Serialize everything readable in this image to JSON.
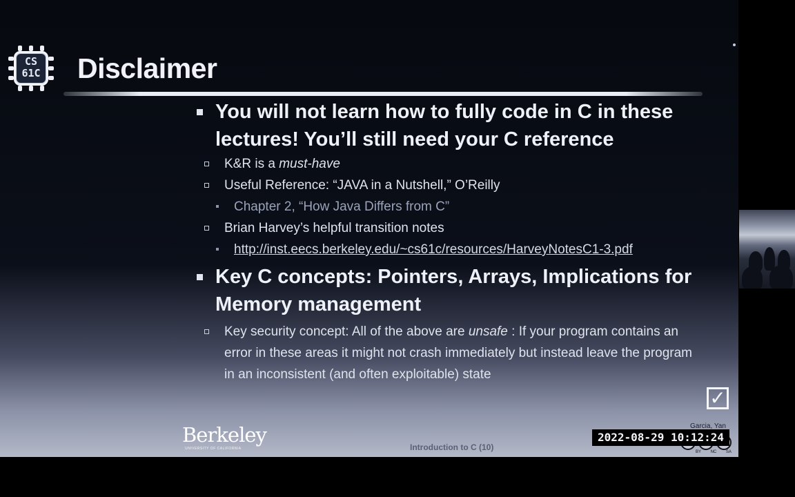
{
  "slide": {
    "logo": "CS\n61C",
    "title": "Disclaimer",
    "bullets": [
      {
        "level": 1,
        "text": "You will not learn how to fully code in C in these lectures! You’ll still need your C reference"
      },
      {
        "level": 2,
        "prefix": "K&R is a ",
        "emphasis": "must-have",
        "suffix": ""
      },
      {
        "level": 2,
        "text": "Useful Reference: “JAVA in a Nutshell,” O’Reilly"
      },
      {
        "level": 3,
        "text": "Chapter 2, “How Java Differs from C”"
      },
      {
        "level": 2,
        "text": "Brian Harvey’s helpful transition notes"
      },
      {
        "level": 3,
        "link": "http://inst.eecs.berkeley.edu/~cs61c/resources/HarveyNotesC1-3.pdf"
      },
      {
        "level": 1,
        "text": "Key C concepts: Pointers, Arrays, Implications for Memory management"
      },
      {
        "level": 2,
        "prefix": "Key security concept: All of the above are ",
        "emphasis": "unsafe",
        "suffix": " : If your program contains an error in these areas it might not crash immediately but instead leave the program in an inconsistent (and often exploitable) state"
      }
    ],
    "footer": {
      "checkbox": "✓",
      "university": "Berkeley",
      "university_sub": "UNIVERSITY OF CALIFORNIA",
      "lecture": "Introduction to C (10)",
      "author": "Garcia, Yan",
      "timestamp": "2022-08-29  10:12:24",
      "license_labels": "BY NC SA"
    }
  },
  "colors": {
    "background": "#000000",
    "text": "#eef1f8",
    "muted": "#9aa3ba"
  },
  "icons": {
    "logo": "cs61c-chip-logo-icon",
    "checkbox": "checked-box-icon",
    "license": "creative-commons-icon"
  }
}
